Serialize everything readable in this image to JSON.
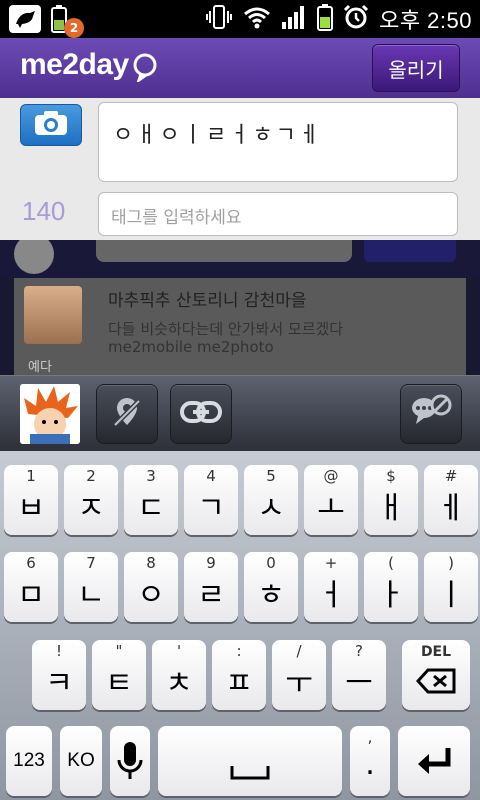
{
  "status_bar": {
    "notification_count": "2",
    "clock": "오후 2:50"
  },
  "header": {
    "logo": "me2day",
    "post_button_label": "올리기"
  },
  "compose": {
    "message_text": "ㅇㅐㅇㅣㄹㅓㅎㄱㅔ",
    "char_counter": "140",
    "tag_placeholder": "태그를 입력하세요"
  },
  "feed": {
    "item": {
      "author": "예다",
      "title": "마추픽추 산토리니 감천마을",
      "body": "다들 비슷하다는데 안가봐서 모르겠다",
      "tags": "me2mobile me2photo"
    }
  },
  "toolbar": {
    "buttons": [
      "location-off",
      "link",
      "comment-off"
    ]
  },
  "keyboard": {
    "row1": [
      {
        "hint": "1",
        "key": "ㅂ"
      },
      {
        "hint": "2",
        "key": "ㅈ"
      },
      {
        "hint": "3",
        "key": "ㄷ"
      },
      {
        "hint": "4",
        "key": "ㄱ"
      },
      {
        "hint": "5",
        "key": "ㅅ"
      },
      {
        "hint": "@",
        "key": "ㅗ"
      },
      {
        "hint": "$",
        "key": "ㅐ"
      },
      {
        "hint": "#",
        "key": "ㅔ"
      }
    ],
    "row2": [
      {
        "hint": "6",
        "key": "ㅁ"
      },
      {
        "hint": "7",
        "key": "ㄴ"
      },
      {
        "hint": "8",
        "key": "ㅇ"
      },
      {
        "hint": "9",
        "key": "ㄹ"
      },
      {
        "hint": "0",
        "key": "ㅎ"
      },
      {
        "hint": "+",
        "key": "ㅓ"
      },
      {
        "hint": "(",
        "key": "ㅏ"
      },
      {
        "hint": ")",
        "key": "ㅣ"
      }
    ],
    "row3": [
      {
        "hint": "!",
        "key": "ㅋ"
      },
      {
        "hint": "\"",
        "key": "ㅌ"
      },
      {
        "hint": "'",
        "key": "ㅊ"
      },
      {
        "hint": ":",
        "key": "ㅍ"
      },
      {
        "hint": "/",
        "key": "ㅜ"
      },
      {
        "hint": "?",
        "key": "ㅡ"
      }
    ],
    "del_label": "DEL",
    "num_label": "123",
    "lang_label": "KO",
    "period_hint": ",",
    "period_label": "."
  }
}
